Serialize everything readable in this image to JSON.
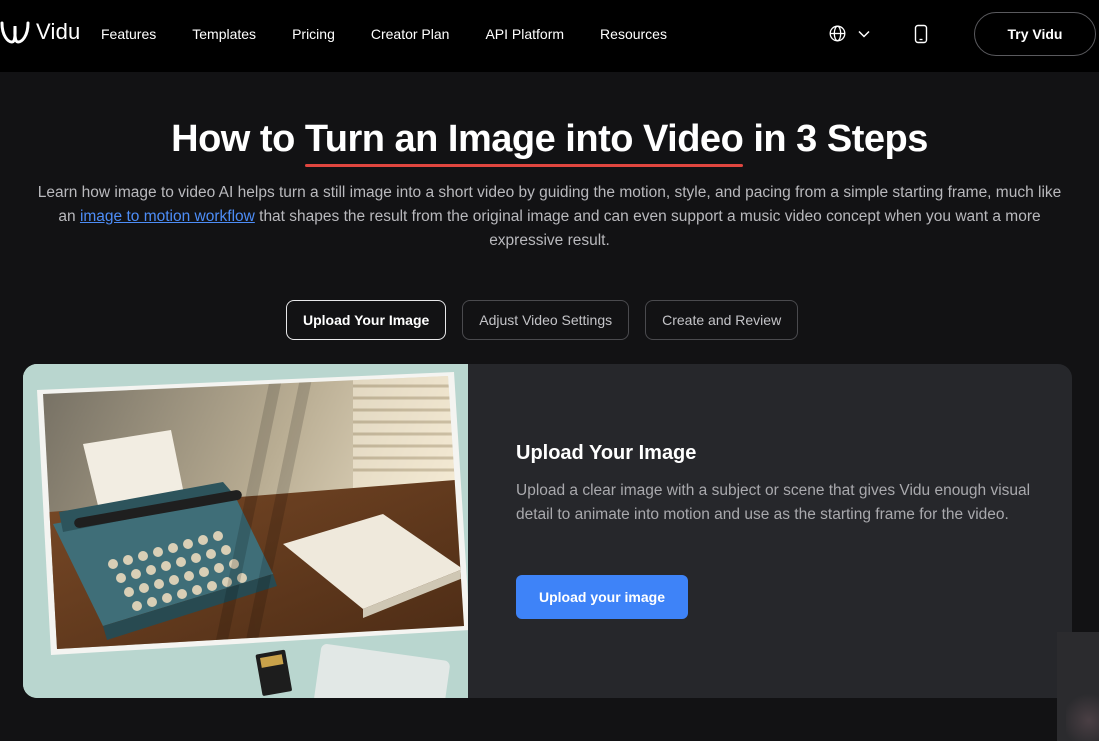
{
  "nav": {
    "logo_text": "Vidu",
    "links": [
      "Features",
      "Templates",
      "Pricing",
      "Creator Plan",
      "API Platform",
      "Resources"
    ],
    "language_icon": "globe-icon",
    "dropdown_icon": "chevron-down-icon",
    "device_icon": "phone-icon",
    "cta": "Try Vidu"
  },
  "hero": {
    "title_before": "How to ",
    "title_highlight": "Turn an Image into Video",
    "title_after": " in 3 Steps",
    "desc_before": "Learn how image to video AI helps turn a still image into a short video by guiding the motion, style, and pacing from a simple starting frame, much like an ",
    "desc_link": "image to motion workflow",
    "desc_after": " that shapes the result from the original image and can even support a music video concept when you want a more expressive result."
  },
  "tabs": [
    {
      "label": "Upload Your Image",
      "active": true
    },
    {
      "label": "Adjust Video Settings",
      "active": false
    },
    {
      "label": "Create and Review",
      "active": false
    }
  ],
  "step": {
    "title": "Upload Your Image",
    "text": "Upload a clear image with a subject or scene that gives Vidu enough visual detail to animate into motion and use as the starting frame for the video.",
    "button": "Upload your image"
  },
  "colors": {
    "accent_blue": "#3e83f8",
    "underline_red": "#e0463f",
    "link_blue": "#4d8df7",
    "card_bg": "#26272b",
    "page_bg": "#121214"
  }
}
